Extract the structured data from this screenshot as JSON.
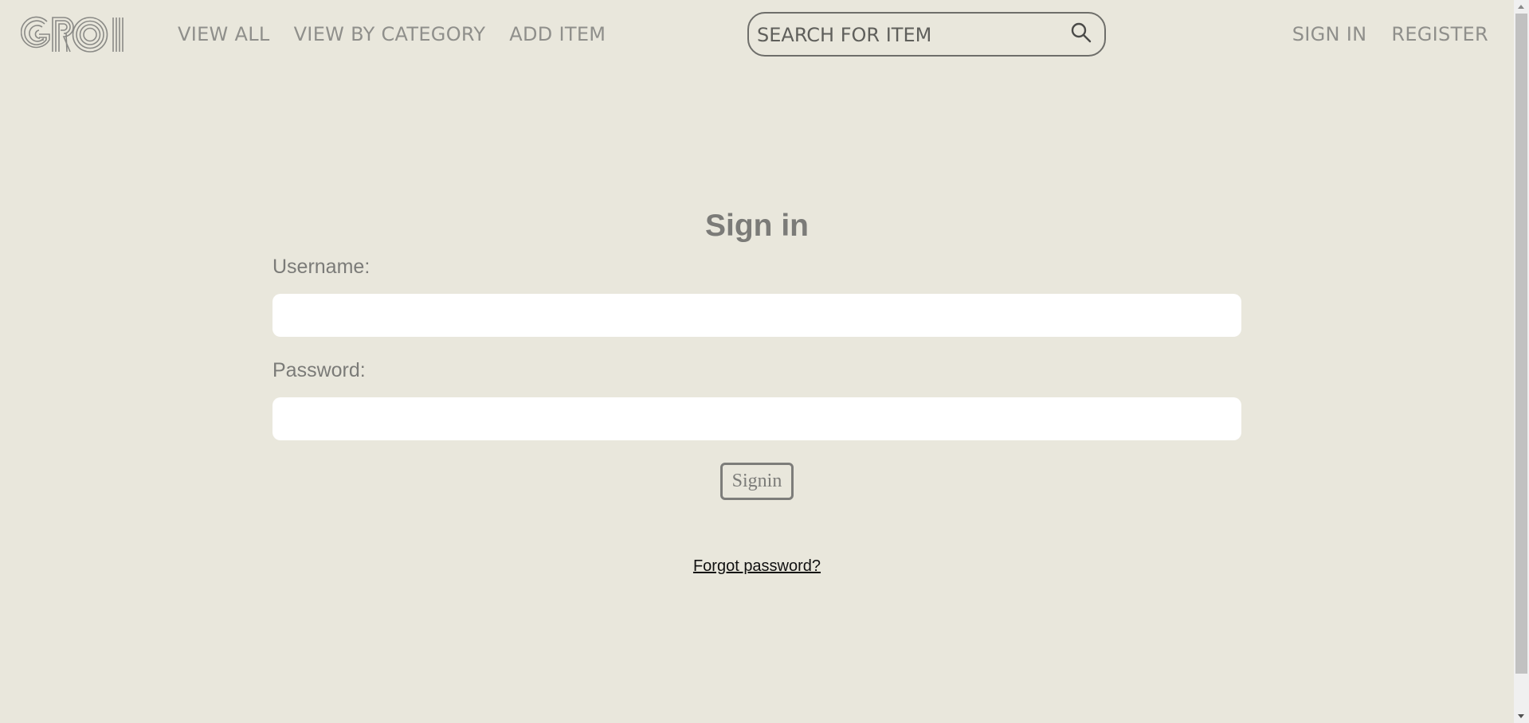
{
  "header": {
    "logo_text": "GROI",
    "nav": [
      {
        "label": "VIEW ALL"
      },
      {
        "label": "VIEW BY CATEGORY"
      },
      {
        "label": "ADD ITEM"
      }
    ],
    "search": {
      "placeholder": "SEARCH FOR ITEM",
      "value": "",
      "icon": "search-icon"
    },
    "auth": {
      "signin_label": "SIGN IN",
      "register_label": "REGISTER"
    }
  },
  "form": {
    "title": "Sign in",
    "username_label": "Username:",
    "username_value": "",
    "password_label": "Password:",
    "password_value": "",
    "submit_label": "Signin",
    "forgot_label": "Forgot password?"
  },
  "colors": {
    "background": "#e9e7dc",
    "nav_text": "#8f8f8b",
    "label_text": "#7b7b78",
    "input_bg": "#ffffff",
    "link_text": "#111111"
  }
}
